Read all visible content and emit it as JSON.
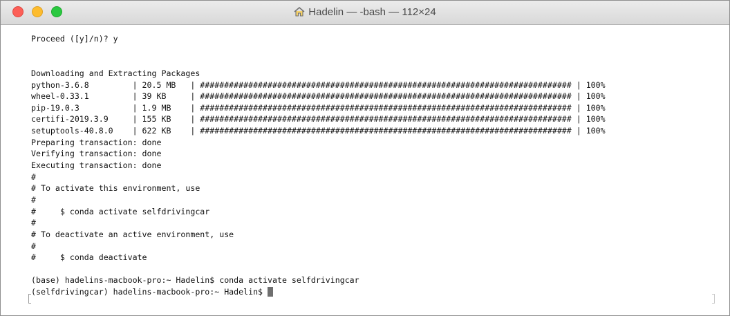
{
  "window": {
    "title": "Hadelin — -bash — 112×24"
  },
  "terminal": {
    "lines": [
      "Proceed ([y]/n)? y",
      "",
      "",
      "Downloading and Extracting Packages",
      "python-3.6.8         | 20.5 MB   | ############################################################################# | 100%",
      "wheel-0.33.1         | 39 KB     | ############################################################################# | 100%",
      "pip-19.0.3           | 1.9 MB    | ############################################################################# | 100%",
      "certifi-2019.3.9     | 155 KB    | ############################################################################# | 100%",
      "setuptools-40.8.0    | 622 KB    | ############################################################################# | 100%",
      "Preparing transaction: done",
      "Verifying transaction: done",
      "Executing transaction: done",
      "#",
      "# To activate this environment, use",
      "#",
      "#     $ conda activate selfdrivingcar",
      "#",
      "# To deactivate an active environment, use",
      "#",
      "#     $ conda deactivate",
      "",
      "(base) hadelins-macbook-pro:~ Hadelin$ conda activate selfdrivingcar",
      "(selfdrivingcar) hadelins-macbook-pro:~ Hadelin$ "
    ]
  },
  "icons": {
    "title_icon": "home-icon",
    "cursor": "block-cursor"
  },
  "colors": {
    "close": "#fc5f57",
    "minimize": "#fdbc2e",
    "maximize": "#2ac840",
    "text": "#111111",
    "background": "#ffffff"
  }
}
